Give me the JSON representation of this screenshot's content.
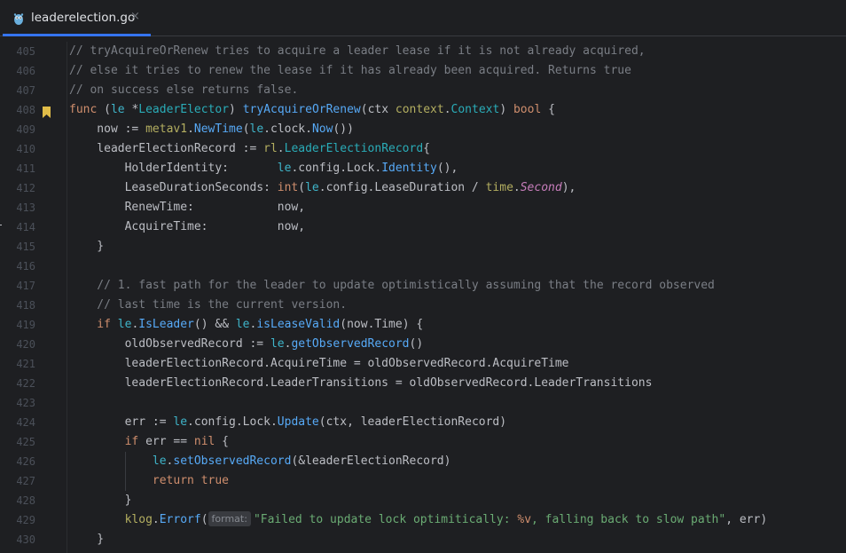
{
  "colors": {
    "background": "#1e1f22",
    "keyword": "#cf8e6d",
    "comment": "#7a7e85",
    "function": "#56a8f5",
    "method_call": "#57aaf7",
    "string": "#6aab73",
    "type": "#2aacb8",
    "receiver": "#3fb4c9",
    "package": "#b3ae60",
    "constant": "#c77dbb",
    "text": "#bcbec4",
    "line_number": "#4b5059",
    "tab_accent": "#3574f0",
    "bookmark": "#e0bc48"
  },
  "tabs": [
    {
      "label": "leaderelection.go",
      "icon": "go-gopher-icon",
      "active": true,
      "close": "×"
    }
  ],
  "editor": {
    "bookmark_line": "408",
    "param_hint": "format:",
    "lines": [
      {
        "num": "405",
        "indent": 0,
        "tokens": [
          {
            "t": "// tryAcquireOrRenew tries to acquire a leader lease if it is not already acquired,",
            "c": "comment"
          }
        ]
      },
      {
        "num": "406",
        "indent": 0,
        "tokens": [
          {
            "t": "// else it tries to renew the lease if it has already been acquired. Returns true",
            "c": "comment"
          }
        ]
      },
      {
        "num": "407",
        "indent": 0,
        "tokens": [
          {
            "t": "// on success else returns false.",
            "c": "comment"
          }
        ]
      },
      {
        "num": "408",
        "indent": 0,
        "tokens": [
          {
            "t": "func",
            "c": "keyword"
          },
          {
            "t": " (",
            "c": "text"
          },
          {
            "t": "le",
            "c": "receiver"
          },
          {
            "t": " *",
            "c": "text"
          },
          {
            "t": "LeaderElector",
            "c": "type"
          },
          {
            "t": ") ",
            "c": "text"
          },
          {
            "t": "tryAcquireOrRenew",
            "c": "function"
          },
          {
            "t": "(ctx ",
            "c": "text"
          },
          {
            "t": "context",
            "c": "package"
          },
          {
            "t": ".",
            "c": "text"
          },
          {
            "t": "Context",
            "c": "type"
          },
          {
            "t": ") ",
            "c": "text"
          },
          {
            "t": "bool",
            "c": "keyword"
          },
          {
            "t": " {",
            "c": "text"
          }
        ]
      },
      {
        "num": "409",
        "indent": 1,
        "tokens": [
          {
            "t": "now := ",
            "c": "text"
          },
          {
            "t": "metav1",
            "c": "package"
          },
          {
            "t": ".",
            "c": "text"
          },
          {
            "t": "NewTime",
            "c": "method_call"
          },
          {
            "t": "(",
            "c": "text"
          },
          {
            "t": "le",
            "c": "receiver"
          },
          {
            "t": ".clock.",
            "c": "text"
          },
          {
            "t": "Now",
            "c": "method_call"
          },
          {
            "t": "())",
            "c": "text"
          }
        ]
      },
      {
        "num": "410",
        "indent": 1,
        "tokens": [
          {
            "t": "leaderElectionRecord := ",
            "c": "text"
          },
          {
            "t": "rl",
            "c": "package"
          },
          {
            "t": ".",
            "c": "text"
          },
          {
            "t": "LeaderElectionRecord",
            "c": "type"
          },
          {
            "t": "{",
            "c": "text"
          }
        ]
      },
      {
        "num": "411",
        "indent": 2,
        "tokens": [
          {
            "t": "HolderIdentity:       ",
            "c": "text"
          },
          {
            "t": "le",
            "c": "receiver"
          },
          {
            "t": ".config.Lock.",
            "c": "text"
          },
          {
            "t": "Identity",
            "c": "method_call"
          },
          {
            "t": "(),",
            "c": "text"
          }
        ]
      },
      {
        "num": "412",
        "indent": 2,
        "tokens": [
          {
            "t": "LeaseDurationSeconds: ",
            "c": "text"
          },
          {
            "t": "int",
            "c": "keyword"
          },
          {
            "t": "(",
            "c": "text"
          },
          {
            "t": "le",
            "c": "receiver"
          },
          {
            "t": ".config.LeaseDuration / ",
            "c": "text"
          },
          {
            "t": "time",
            "c": "package"
          },
          {
            "t": ".",
            "c": "text"
          },
          {
            "t": "Second",
            "c": "constant_italic"
          },
          {
            "t": "),",
            "c": "text"
          }
        ]
      },
      {
        "num": "413",
        "indent": 2,
        "tokens": [
          {
            "t": "RenewTime:            now,",
            "c": "text"
          }
        ]
      },
      {
        "num": "414",
        "indent": 2,
        "tokens": [
          {
            "t": "AcquireTime:          now,",
            "c": "text"
          }
        ]
      },
      {
        "num": "415",
        "indent": 1,
        "tokens": [
          {
            "t": "}",
            "c": "text"
          }
        ]
      },
      {
        "num": "416",
        "indent": 0,
        "tokens": []
      },
      {
        "num": "417",
        "indent": 1,
        "tokens": [
          {
            "t": "// 1. fast path for the leader to update optimistically assuming that the record observed",
            "c": "comment"
          }
        ]
      },
      {
        "num": "418",
        "indent": 1,
        "tokens": [
          {
            "t": "// last time is the current version.",
            "c": "comment"
          }
        ]
      },
      {
        "num": "419",
        "indent": 1,
        "tokens": [
          {
            "t": "if",
            "c": "keyword"
          },
          {
            "t": " ",
            "c": "text"
          },
          {
            "t": "le",
            "c": "receiver"
          },
          {
            "t": ".",
            "c": "text"
          },
          {
            "t": "IsLeader",
            "c": "method_call"
          },
          {
            "t": "() && ",
            "c": "text"
          },
          {
            "t": "le",
            "c": "receiver"
          },
          {
            "t": ".",
            "c": "text"
          },
          {
            "t": "isLeaseValid",
            "c": "method_call"
          },
          {
            "t": "(now.Time) {",
            "c": "text"
          }
        ]
      },
      {
        "num": "420",
        "indent": 2,
        "tokens": [
          {
            "t": "oldObservedRecord := ",
            "c": "text"
          },
          {
            "t": "le",
            "c": "receiver"
          },
          {
            "t": ".",
            "c": "text"
          },
          {
            "t": "getObservedRecord",
            "c": "method_call"
          },
          {
            "t": "()",
            "c": "text"
          }
        ]
      },
      {
        "num": "421",
        "indent": 2,
        "tokens": [
          {
            "t": "leaderElectionRecord.AcquireTime = oldObservedRecord.AcquireTime",
            "c": "text"
          }
        ]
      },
      {
        "num": "422",
        "indent": 2,
        "tokens": [
          {
            "t": "leaderElectionRecord.LeaderTransitions = oldObservedRecord.LeaderTransitions",
            "c": "text"
          }
        ]
      },
      {
        "num": "423",
        "indent": 0,
        "tokens": []
      },
      {
        "num": "424",
        "indent": 2,
        "tokens": [
          {
            "t": "err := ",
            "c": "text"
          },
          {
            "t": "le",
            "c": "receiver"
          },
          {
            "t": ".config.Lock.",
            "c": "text"
          },
          {
            "t": "Update",
            "c": "method_call"
          },
          {
            "t": "(ctx, leaderElectionRecord)",
            "c": "text"
          }
        ]
      },
      {
        "num": "425",
        "indent": 2,
        "tokens": [
          {
            "t": "if",
            "c": "keyword"
          },
          {
            "t": " err == ",
            "c": "text"
          },
          {
            "t": "nil",
            "c": "keyword"
          },
          {
            "t": " {",
            "c": "text"
          }
        ]
      },
      {
        "num": "426",
        "indent": 3,
        "tokens": [
          {
            "t": "le",
            "c": "receiver"
          },
          {
            "t": ".",
            "c": "text"
          },
          {
            "t": "setObservedRecord",
            "c": "method_call"
          },
          {
            "t": "(&leaderElectionRecord)",
            "c": "text"
          }
        ]
      },
      {
        "num": "427",
        "indent": 3,
        "tokens": [
          {
            "t": "return",
            "c": "keyword"
          },
          {
            "t": " ",
            "c": "text"
          },
          {
            "t": "true",
            "c": "keyword"
          }
        ]
      },
      {
        "num": "428",
        "indent": 2,
        "tokens": [
          {
            "t": "}",
            "c": "text"
          }
        ]
      },
      {
        "num": "429",
        "indent": 2,
        "tokens": [
          {
            "t": "klog",
            "c": "package"
          },
          {
            "t": ".",
            "c": "text"
          },
          {
            "t": "Errorf",
            "c": "method_call"
          },
          {
            "t": "(",
            "c": "text"
          },
          {
            "t": "format:",
            "c": "hint"
          },
          {
            "t": "\"Failed to update lock optimitically: ",
            "c": "string"
          },
          {
            "t": "%v",
            "c": "keyword"
          },
          {
            "t": ", falling back to slow path\"",
            "c": "string"
          },
          {
            "t": ", err)",
            "c": "text"
          }
        ]
      },
      {
        "num": "430",
        "indent": 1,
        "tokens": [
          {
            "t": "}",
            "c": "text"
          }
        ]
      }
    ]
  }
}
